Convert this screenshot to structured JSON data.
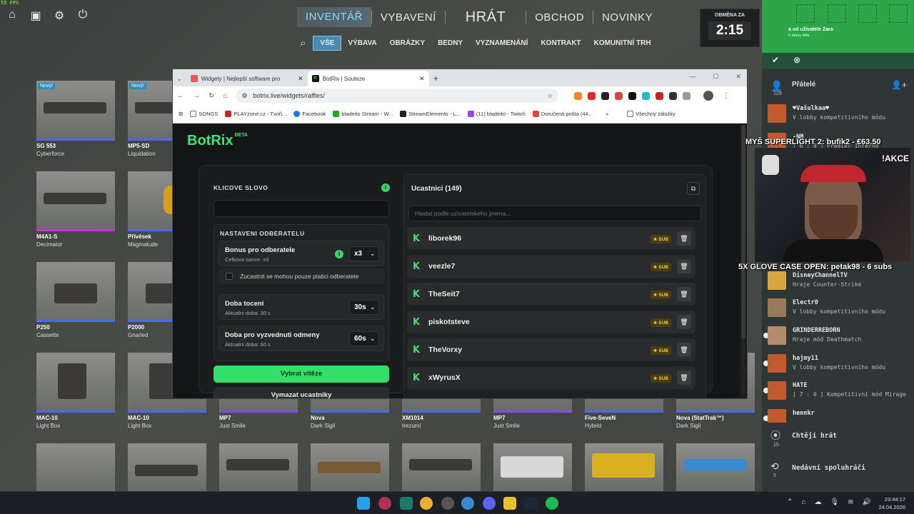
{
  "fps": "55 FPS",
  "game_nav": {
    "items": [
      "INVENTÁŘ",
      "VYBAVENÍ",
      "HRÁT",
      "OBCHOD",
      "NOVINKY"
    ],
    "active": "INVENTÁŘ",
    "sub": [
      "VŠE",
      "VÝBAVA",
      "OBRÁZKY",
      "BEDNY",
      "VYZNAMENÁNÍ",
      "KONTRAKT",
      "KOMUNITNÍ TRH"
    ]
  },
  "timer": {
    "label": "OBMĚNA ZA",
    "value": "2:15"
  },
  "inventory": {
    "new_badge": "Nový!",
    "items": [
      {
        "name": "SG 553",
        "skin": "Cyberforce",
        "new": true
      },
      {
        "name": "MP5-SD",
        "skin": "Liquidation",
        "new": true
      },
      {
        "name": "M4A1-S",
        "skin": "Decimator"
      },
      {
        "name": "Přívěsek",
        "skin": "Magmatude"
      },
      {
        "name": "P250",
        "skin": "Cassette"
      },
      {
        "name": "P2000",
        "skin": "Gnarled"
      },
      {
        "name": "MAC-10",
        "skin": "Light Box"
      },
      {
        "name": "MAC-10",
        "skin": "Light Box"
      },
      {
        "name": "MP7",
        "skin": "Just Smile"
      },
      {
        "name": "Nova",
        "skin": "Dark Sigil"
      },
      {
        "name": "XM1014",
        "skin": "Irezumi"
      },
      {
        "name": "MP7",
        "skin": "Just Smile"
      },
      {
        "name": "Five-SeveN",
        "skin": "Hybrid"
      },
      {
        "name": "Nova (StatTrak™)",
        "skin": "Dark Sigil"
      }
    ]
  },
  "browser": {
    "tabs": [
      {
        "title": "Widgety | Nejlepší software pro",
        "active": false
      },
      {
        "title": "BotRix | Souteze",
        "active": true
      }
    ],
    "url": "botrix.live/widgets/raffles/",
    "bookmarks": [
      "SONGS",
      "PLAYzone.cz - Tvoři...",
      "Facebook",
      "bladeito Stream - W...",
      "StreamElements - L...",
      "(11) bladeito - Twitch",
      "Doručená pošta (44...",
      "Všechny záložky"
    ]
  },
  "botrix": {
    "brand": "BotRix",
    "beta": "BETA",
    "keyword_label": "KLICOVE SLOVO",
    "sub_settings_label": "NASTAVENI ODBERATELU",
    "bonus": {
      "title": "Bonus pro odberatele",
      "desc": "Celkova sance: x3",
      "value": "x3"
    },
    "paid_only": "Zucastnit se mohou pouze platici odberatele",
    "spin": {
      "title": "Doba toceni",
      "desc": "Aktualni doba: 30 s",
      "value": "30s"
    },
    "claim": {
      "title": "Doba pro vyzvednuti odmeny",
      "desc": "Aktualni doba: 60 s",
      "value": "60s"
    },
    "pick_winner": "Vybrat vítěze",
    "clear": "Vymazat ucastniky",
    "participants_title": "Ucastnici (149)",
    "search_placeholder": "Hledat podle uzivatelskeho jmena...",
    "sub_badge": "SUB",
    "participants": [
      "liborek96",
      "veezle7",
      "TheSeit7",
      "piskotsteve",
      "TheVorxy",
      "xWyrusX"
    ]
  },
  "friends": {
    "invite_from": "a od uživatele Zara",
    "invite_sub": "h\nmbou Alfa",
    "header": "Přátelé",
    "count": "129",
    "list": [
      {
        "name": "♥Vašulkaa♥",
        "status": "V lobby kompetitivního módu"
      },
      {
        "name": "-NM",
        "status": "[ 6 : 8 ] Premier Inferno"
      },
      {
        "name": "DisneyChannelTV",
        "status": "Hraje Counter-Strike"
      },
      {
        "name": "Electr0",
        "status": "V lobby kompetitivního módu"
      },
      {
        "name": "GRINDERREBORN",
        "status": "Hraje mód Deathmatch"
      },
      {
        "name": "hajmy11",
        "status": "V lobby kompetitivního módu"
      },
      {
        "name": "HATE",
        "status": "[ 7 : 0 ] Kompetitivní mód Mirage"
      },
      {
        "name": "hennkr",
        "status": ""
      }
    ],
    "want_play": "Chtějí hrát",
    "want_play_count": "15",
    "recent": "Nedávní spoluhráči",
    "recent_count": "5"
  },
  "overlay": {
    "top": "MYŠ SUPERLIGHT 2: bufik2 - €63.50",
    "akce": "!AKCE",
    "bottom": "5X GLOVE CASE OPEN: petak98 - 6 subs"
  },
  "taskbar": {
    "time": "23:44:17",
    "date": "24.04.2026"
  }
}
